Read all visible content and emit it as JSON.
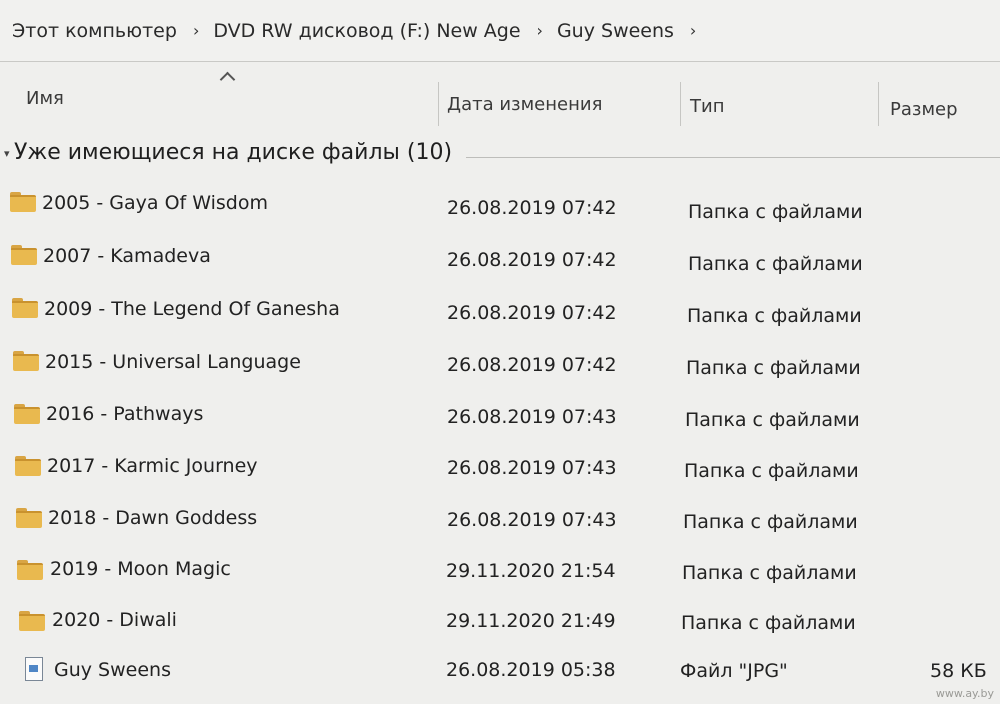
{
  "breadcrumb": {
    "items": [
      {
        "label": "Этот компьютер"
      },
      {
        "label": "DVD RW дисковод (F:) New Age"
      },
      {
        "label": "Guy Sweens"
      }
    ],
    "separator": "›"
  },
  "columns": {
    "name": "Имя",
    "date": "Дата изменения",
    "type": "Тип",
    "size": "Размер"
  },
  "group": {
    "title": "Уже имеющиеся на диске файлы (10)",
    "chevron": "▾"
  },
  "files": [
    {
      "name": "2005 - Gaya Of Wisdom",
      "date": "26.08.2019 07:42",
      "type": "Папка с файлами",
      "size": "",
      "icon": "folder-icon"
    },
    {
      "name": "2007 - Kamadeva",
      "date": "26.08.2019 07:42",
      "type": "Папка с файлами",
      "size": "",
      "icon": "folder-icon"
    },
    {
      "name": "2009 - The Legend Of Ganesha",
      "date": "26.08.2019 07:42",
      "type": "Папка с файлами",
      "size": "",
      "icon": "folder-icon"
    },
    {
      "name": "2015 - Universal Language",
      "date": "26.08.2019 07:42",
      "type": "Папка с файлами",
      "size": "",
      "icon": "folder-icon"
    },
    {
      "name": "2016 - Pathways",
      "date": "26.08.2019 07:43",
      "type": "Папка с файлами",
      "size": "",
      "icon": "folder-icon"
    },
    {
      "name": "2017 - Karmic Journey",
      "date": "26.08.2019 07:43",
      "type": "Папка с файлами",
      "size": "",
      "icon": "folder-icon"
    },
    {
      "name": "2018 - Dawn Goddess",
      "date": "26.08.2019 07:43",
      "type": "Папка с файлами",
      "size": "",
      "icon": "folder-icon"
    },
    {
      "name": "2019 - Moon Magic",
      "date": "29.11.2020 21:54",
      "type": "Папка с файлами",
      "size": "",
      "icon": "folder-icon"
    },
    {
      "name": "2020 - Diwali",
      "date": "29.11.2020 21:49",
      "type": "Папка с файлами",
      "size": "",
      "icon": "folder-icon"
    },
    {
      "name": "Guy Sweens",
      "date": "26.08.2019 05:38",
      "type": "Файл \"JPG\"",
      "size": "58 КБ",
      "icon": "jpg-file-icon"
    }
  ],
  "watermark": "www.ay.by",
  "colors": {
    "folder": "#e9b94f",
    "background": "#efefed"
  }
}
